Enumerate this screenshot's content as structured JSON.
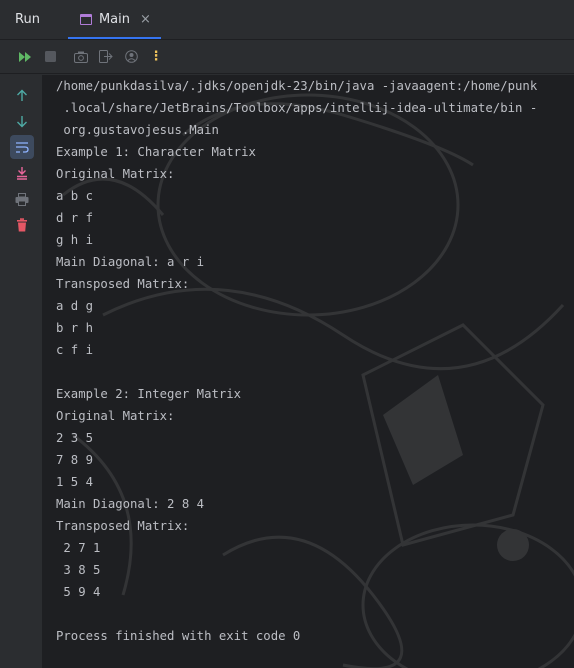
{
  "tabbar": {
    "run_label": "Run",
    "tab_label": "Main",
    "close_glyph": "×"
  },
  "toolbar": {
    "icons": [
      "rerun-icon",
      "stop-icon",
      "screenshot-icon",
      "exit-icon",
      "profiler-icon",
      "more-icon"
    ],
    "more_glyph": "⋮"
  },
  "sidebar": {
    "icons": [
      "arrow-up-icon",
      "arrow-down-icon",
      "soft-wrap-icon",
      "scroll-to-end-icon",
      "print-icon",
      "trash-icon"
    ]
  },
  "console": {
    "lines": [
      "/home/punkdasilva/.jdks/openjdk-23/bin/java -javaagent:/home/punk",
      " .local/share/JetBrains/Toolbox/apps/intellij-idea-ultimate/bin -",
      " org.gustavojesus.Main",
      "Example 1: Character Matrix",
      "Original Matrix:",
      "a b c",
      "d r f",
      "g h i",
      "Main Diagonal: a r i",
      "Transposed Matrix:",
      "a d g",
      "b r h",
      "c f i",
      "",
      "Example 2: Integer Matrix",
      "Original Matrix:",
      "2 3 5",
      "7 8 9",
      "1 5 4",
      "Main Diagonal: 2 8 4",
      "Transposed Matrix:",
      " 2 7 1",
      " 3 8 5",
      " 5 9 4",
      "",
      "Process finished with exit code 0"
    ]
  },
  "colors": {
    "console_bg": "#1e1f22",
    "panel_bg": "#2b2d30",
    "accent": "#3574f0"
  }
}
